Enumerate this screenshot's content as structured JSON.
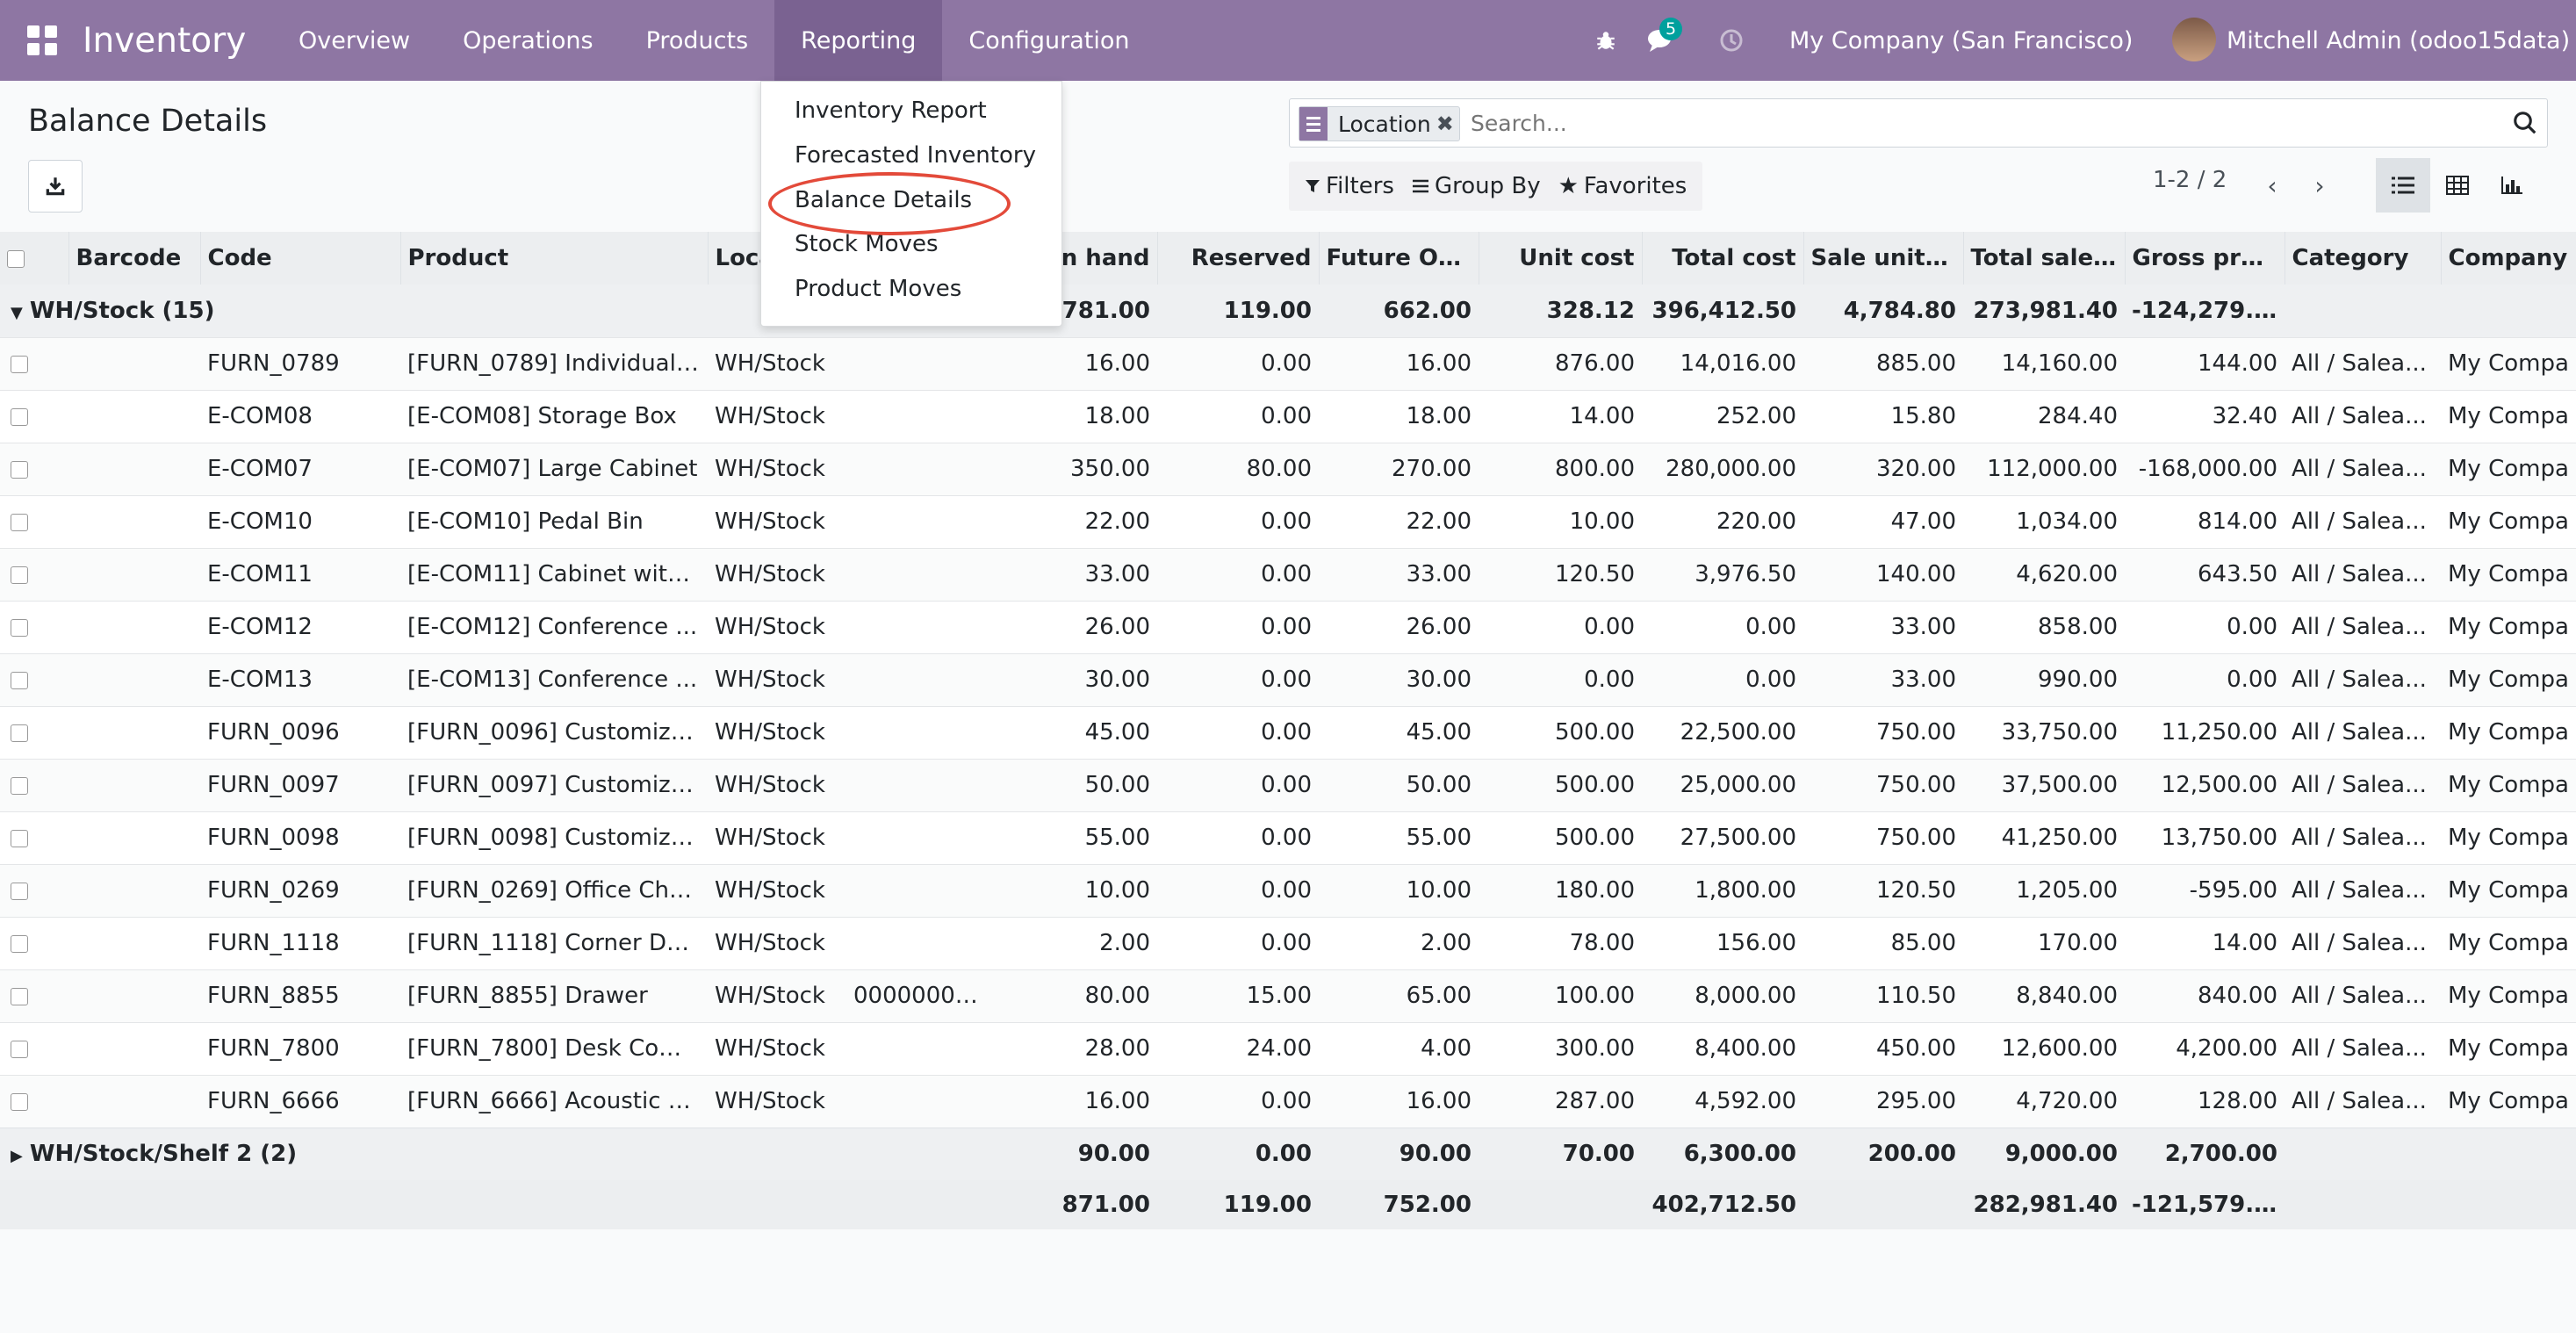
{
  "navbar": {
    "brand": "Inventory",
    "menu": [
      "Overview",
      "Operations",
      "Products",
      "Reporting",
      "Configuration"
    ],
    "active_menu": "Reporting",
    "messages_badge": "5",
    "company": "My Company (San Francisco)",
    "user": "Mitchell Admin (odoo15data)",
    "colors": {
      "navbar": "#8e76a3",
      "navbar_active": "#7a6291",
      "badge": "#00a09d",
      "highlight": "#e34a3a"
    }
  },
  "control": {
    "title": "Balance Details",
    "search_facet": "Location",
    "search_placeholder": "Search...",
    "filters_label": "Filters",
    "groupby_label": "Group By",
    "favorites_label": "Favorites",
    "pager": "1-2 / 2"
  },
  "dropdown": {
    "items": [
      "Inventory Report",
      "Forecasted Inventory",
      "Balance Details",
      "Stock Moves",
      "Product Moves"
    ],
    "highlighted": "Balance Details"
  },
  "table": {
    "columns": [
      "Barcode",
      "Code",
      "Product",
      "Loca",
      "n hand",
      "Reserved",
      "Future On...",
      "Unit cost",
      "Total cost",
      "Sale unit p...",
      "Total sale ...",
      "Gross pro...",
      "Category",
      "Company"
    ],
    "groups": [
      {
        "label": "WH/Stock (15)",
        "expanded": true,
        "totals": [
          "781.00",
          "119.00",
          "662.00",
          "328.12",
          "396,412.50",
          "4,784.80",
          "273,981.40",
          "-124,279.10"
        ],
        "rows": [
          [
            "",
            "FURN_0789",
            "[FURN_0789] Individual ...",
            "WH/Stock",
            "",
            "16.00",
            "0.00",
            "16.00",
            "876.00",
            "14,016.00",
            "885.00",
            "14,160.00",
            "144.00",
            "All / Salea...",
            "My Compa"
          ],
          [
            "",
            "E-COM08",
            "[E-COM08] Storage Box",
            "WH/Stock",
            "",
            "18.00",
            "0.00",
            "18.00",
            "14.00",
            "252.00",
            "15.80",
            "284.40",
            "32.40",
            "All / Salea...",
            "My Compa"
          ],
          [
            "",
            "E-COM07",
            "[E-COM07] Large Cabinet",
            "WH/Stock",
            "",
            "350.00",
            "80.00",
            "270.00",
            "800.00",
            "280,000.00",
            "320.00",
            "112,000.00",
            "-168,000.00",
            "All / Salea...",
            "My Compa"
          ],
          [
            "",
            "E-COM10",
            "[E-COM10] Pedal Bin",
            "WH/Stock",
            "",
            "22.00",
            "0.00",
            "22.00",
            "10.00",
            "220.00",
            "47.00",
            "1,034.00",
            "814.00",
            "All / Salea...",
            "My Compa"
          ],
          [
            "",
            "E-COM11",
            "[E-COM11] Cabinet with...",
            "WH/Stock",
            "",
            "33.00",
            "0.00",
            "33.00",
            "120.50",
            "3,976.50",
            "140.00",
            "4,620.00",
            "643.50",
            "All / Salea...",
            "My Compa"
          ],
          [
            "",
            "E-COM12",
            "[E-COM12] Conference ...",
            "WH/Stock",
            "",
            "26.00",
            "0.00",
            "26.00",
            "0.00",
            "0.00",
            "33.00",
            "858.00",
            "0.00",
            "All / Salea...",
            "My Compa"
          ],
          [
            "",
            "E-COM13",
            "[E-COM13] Conference ...",
            "WH/Stock",
            "",
            "30.00",
            "0.00",
            "30.00",
            "0.00",
            "0.00",
            "33.00",
            "990.00",
            "0.00",
            "All / Salea...",
            "My Compa"
          ],
          [
            "",
            "FURN_0096",
            "[FURN_0096] Customiza...",
            "WH/Stock",
            "",
            "45.00",
            "0.00",
            "45.00",
            "500.00",
            "22,500.00",
            "750.00",
            "33,750.00",
            "11,250.00",
            "All / Salea...",
            "My Compa"
          ],
          [
            "",
            "FURN_0097",
            "[FURN_0097] Customiza...",
            "WH/Stock",
            "",
            "50.00",
            "0.00",
            "50.00",
            "500.00",
            "25,000.00",
            "750.00",
            "37,500.00",
            "12,500.00",
            "All / Salea...",
            "My Compa"
          ],
          [
            "",
            "FURN_0098",
            "[FURN_0098] Customiza...",
            "WH/Stock",
            "",
            "55.00",
            "0.00",
            "55.00",
            "500.00",
            "27,500.00",
            "750.00",
            "41,250.00",
            "13,750.00",
            "All / Salea...",
            "My Compa"
          ],
          [
            "",
            "FURN_0269",
            "[FURN_0269] Office Chai...",
            "WH/Stock",
            "",
            "10.00",
            "0.00",
            "10.00",
            "180.00",
            "1,800.00",
            "120.50",
            "1,205.00",
            "-595.00",
            "All / Salea...",
            "My Compa"
          ],
          [
            "",
            "FURN_1118",
            "[FURN_1118] Corner De...",
            "WH/Stock",
            "",
            "2.00",
            "0.00",
            "2.00",
            "78.00",
            "156.00",
            "85.00",
            "170.00",
            "14.00",
            "All / Salea...",
            "My Compa"
          ],
          [
            "",
            "FURN_8855",
            "[FURN_8855] Drawer",
            "WH/Stock",
            "00000000...",
            "80.00",
            "15.00",
            "65.00",
            "100.00",
            "8,000.00",
            "110.50",
            "8,840.00",
            "840.00",
            "All / Salea...",
            "My Compa"
          ],
          [
            "",
            "FURN_7800",
            "[FURN_7800] Desk Com...",
            "WH/Stock",
            "",
            "28.00",
            "24.00",
            "4.00",
            "300.00",
            "8,400.00",
            "450.00",
            "12,600.00",
            "4,200.00",
            "All / Salea...",
            "My Compa"
          ],
          [
            "",
            "FURN_6666",
            "[FURN_6666] Acoustic Bl...",
            "WH/Stock",
            "",
            "16.00",
            "0.00",
            "16.00",
            "287.00",
            "4,592.00",
            "295.00",
            "4,720.00",
            "128.00",
            "All / Salea...",
            "My Compa"
          ]
        ]
      },
      {
        "label": "WH/Stock/Shelf 2 (2)",
        "expanded": false,
        "totals": [
          "90.00",
          "0.00",
          "90.00",
          "70.00",
          "6,300.00",
          "200.00",
          "9,000.00",
          "2,700.00"
        ],
        "rows": []
      }
    ],
    "footer": [
      "871.00",
      "119.00",
      "752.00",
      "",
      "402,712.50",
      "",
      "282,981.40",
      "-121,579.10"
    ]
  }
}
